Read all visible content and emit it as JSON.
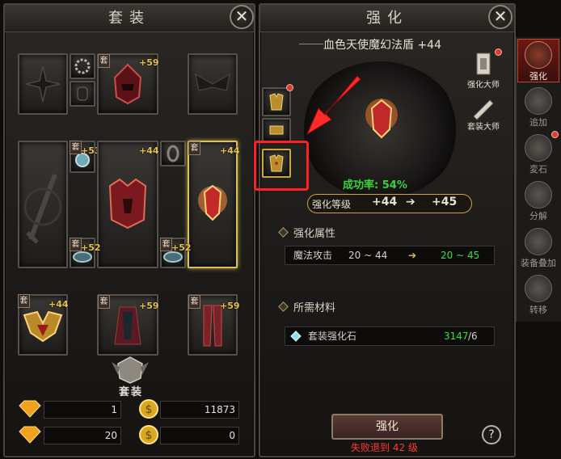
{
  "left_panel": {
    "title": "套装",
    "close_glyph": "✕",
    "set_badge_label": "套装",
    "tao_glyph": "套",
    "slots": {
      "helmet_level": "+59",
      "chest_level": "+44",
      "shield_level": "+44",
      "ring_left_level": "+53",
      "bracelet_left_level": "+52",
      "bracelet_right_level": "+52",
      "shoulder_level": "+44",
      "armor_level": "+59",
      "leggings_level": "+59"
    },
    "resources": [
      {
        "icon": "diamond-icon",
        "value": "1"
      },
      {
        "icon": "coin-icon",
        "value": "11873"
      },
      {
        "icon": "diamond-icon",
        "value": "20"
      },
      {
        "icon": "coin-icon",
        "value": "0"
      }
    ]
  },
  "right_panel": {
    "title": "强化",
    "item_name": "血色天使魔幻法盾 +44",
    "master_refine": "强化大师",
    "master_set": "套装大师",
    "success_label": "成功率: 54%",
    "refine_level_label": "强化等级",
    "level_from": "+44",
    "arrow": "➔",
    "level_to": "+45",
    "attr_section": "强化属性",
    "attr_name": "魔法攻击",
    "attr_from": "20 ~ 44",
    "attr_arrow": "➔",
    "attr_to": "20 ~ 45",
    "material_section": "所需材料",
    "material_name": "套装强化石",
    "material_have": "3147",
    "material_need": "/6",
    "refine_button": "强化",
    "fail_note": "失败退到 42 级",
    "help_glyph": "?"
  },
  "sidebar": [
    {
      "label": "强化",
      "icon": "hammer-icon",
      "active": true
    },
    {
      "label": "追加",
      "icon": "plus-emblem-icon",
      "active": false
    },
    {
      "label": "変石",
      "icon": "stone-icon",
      "active": false
    },
    {
      "label": "分解",
      "icon": "decompose-icon",
      "active": false
    },
    {
      "label": "装备叠加",
      "icon": "stack-armor-icon",
      "active": false
    },
    {
      "label": "转移",
      "icon": "transfer-icon",
      "active": false
    }
  ],
  "colors": {
    "success": "#39d23a",
    "level_gold": "#e6c04a",
    "attr_up": "#36e03a",
    "fail_red": "#ff3a2a",
    "highlight_red": "#ff2020"
  }
}
